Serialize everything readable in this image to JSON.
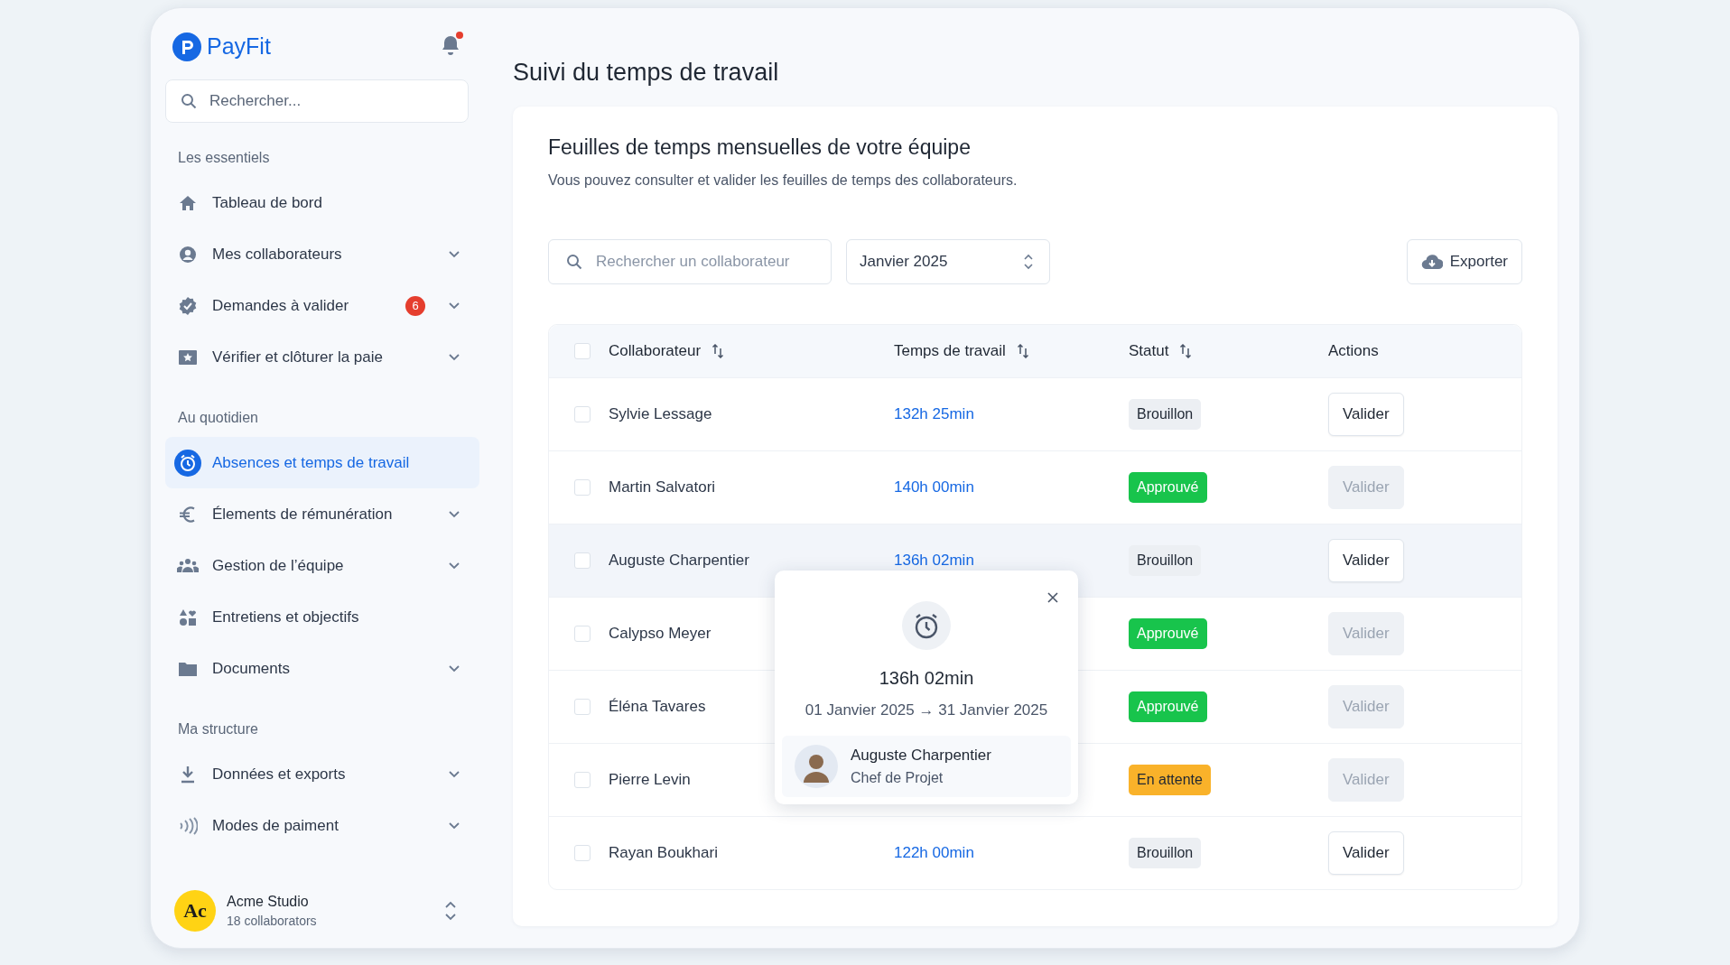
{
  "brand": {
    "name": "PayFit",
    "notification_unread": true
  },
  "sidebar": {
    "search": {
      "placeholder": "Rechercher..."
    },
    "sections": [
      {
        "title": "Les essentiels",
        "items": [
          {
            "label": "Tableau de bord",
            "expandable": false,
            "selected": false
          },
          {
            "label": "Mes collaborateurs",
            "expandable": true,
            "selected": false
          },
          {
            "label": "Demandes à valider",
            "badge": "6",
            "expandable": true,
            "selected": false
          },
          {
            "label": "Vérifier et clôturer la paie",
            "expandable": true,
            "selected": false
          }
        ]
      },
      {
        "title": "Au quotidien",
        "items": [
          {
            "label": "Absences et temps de travail",
            "expandable": false,
            "selected": true
          },
          {
            "label": "Élements de rémunération",
            "expandable": true,
            "selected": false
          },
          {
            "label": "Gestion de l’équipe",
            "expandable": true,
            "selected": false
          },
          {
            "label": "Entretiens et objectifs",
            "expandable": false,
            "selected": false
          },
          {
            "label": "Documents",
            "expandable": true,
            "selected": false
          }
        ]
      },
      {
        "title": "Ma structure",
        "items": [
          {
            "label": "Données et exports",
            "expandable": true,
            "selected": false
          },
          {
            "label": "Modes de paiment",
            "expandable": true,
            "selected": false
          }
        ]
      }
    ]
  },
  "org": {
    "initials": "Ac",
    "name": "Acme Studio",
    "subtitle": "18 collaborators"
  },
  "page": {
    "title": "Suivi du temps de travail"
  },
  "card": {
    "title": "Feuilles de temps mensuelles de votre équipe",
    "subtitle": "Vous pouvez consulter et valider les feuilles de temps des collaborateurs.",
    "search": {
      "placeholder": "Rechercher un collaborateur"
    },
    "period": {
      "value": "Janvier 2025"
    },
    "export_button": "Exporter"
  },
  "table": {
    "header_checked": false,
    "columns": [
      {
        "label": "Collaborateur",
        "sortable": true
      },
      {
        "label": "Temps de travail",
        "sortable": true
      },
      {
        "label": "Statut",
        "sortable": true
      },
      {
        "label": "Actions",
        "sortable": false
      }
    ],
    "rows": [
      {
        "name": "Sylvie Lessage",
        "time": "132h 25min",
        "status": {
          "label": "Brouillon",
          "kind": "draft"
        },
        "action": {
          "label": "Valider",
          "disabled": false
        },
        "highlighted": false,
        "checked": false
      },
      {
        "name": "Martin Salvatori",
        "time": "140h 00min",
        "status": {
          "label": "Approuvé",
          "kind": "approved"
        },
        "action": {
          "label": "Valider",
          "disabled": true
        },
        "highlighted": false,
        "checked": false
      },
      {
        "name": "Auguste Charpentier",
        "time": "136h 02min",
        "status": {
          "label": "Brouillon",
          "kind": "draft"
        },
        "action": {
          "label": "Valider",
          "disabled": false
        },
        "highlighted": true,
        "checked": false
      },
      {
        "name": "Calypso Meyer",
        "status": {
          "label": "Approuvé",
          "kind": "approved"
        },
        "action": {
          "label": "Valider",
          "disabled": true
        },
        "highlighted": false,
        "checked": false
      },
      {
        "name": "Éléna Tavares",
        "status": {
          "label": "Approuvé",
          "kind": "approved"
        },
        "action": {
          "label": "Valider",
          "disabled": true
        },
        "highlighted": false,
        "checked": false
      },
      {
        "name": "Pierre Levin",
        "status": {
          "label": "En attente",
          "kind": "pending"
        },
        "action": {
          "label": "Valider",
          "disabled": true
        },
        "highlighted": false,
        "checked": false
      },
      {
        "name": "Rayan Boukhari",
        "time": "122h 00min",
        "status": {
          "label": "Brouillon",
          "kind": "draft"
        },
        "action": {
          "label": "Valider",
          "disabled": false
        },
        "highlighted": false,
        "checked": false
      }
    ]
  },
  "popover": {
    "duration": "136h 02min",
    "range": "01 Janvier 2025 → 31 Janvier 2025",
    "person": {
      "name": "Auguste Charpentier",
      "role": "Chef de Projet"
    }
  }
}
